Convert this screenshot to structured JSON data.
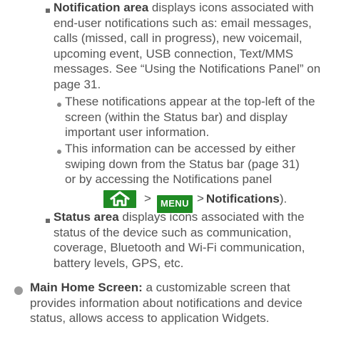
{
  "notification_area": {
    "term": "Notification area",
    "lines": [
      " displays icons associated with",
      "end-user notifications such as: email messages,",
      "calls (missed, call in progress), new voicemail,",
      "upcoming event, USB connection, Text/MMS",
      "messages. See “Using the Notifications Panel” on",
      "page 31."
    ],
    "sub_items": [
      {
        "lines": [
          "These notifications appear at the top-left of the",
          "screen (within the Status bar) and display",
          "important user information."
        ]
      },
      {
        "lines": [
          "This information can be accessed by either",
          "swiping down from the Status bar (page 31)",
          "or by accessing the Notifications panel"
        ],
        "nav": {
          "gt1": ">",
          "menu_key": "MENU",
          "gt2": ">",
          "target": "Notifications",
          "end": ")."
        }
      }
    ]
  },
  "status_area": {
    "term": "Status area",
    "lines": [
      " displays icons associated with the",
      "status of the device such as communication,",
      "coverage, Bluetooth and Wi-Fi communication,",
      "battery levels, GPS, etc."
    ]
  },
  "main_home_screen": {
    "term": "Main Home Screen:",
    "lines": [
      " a customizable screen that",
      "provides information about notifications and device",
      "status, allows access to application Widgets."
    ]
  },
  "icons": {
    "home_key": "home-icon"
  },
  "colors": {
    "key_green": "#1f8b24",
    "text": "#545454"
  }
}
